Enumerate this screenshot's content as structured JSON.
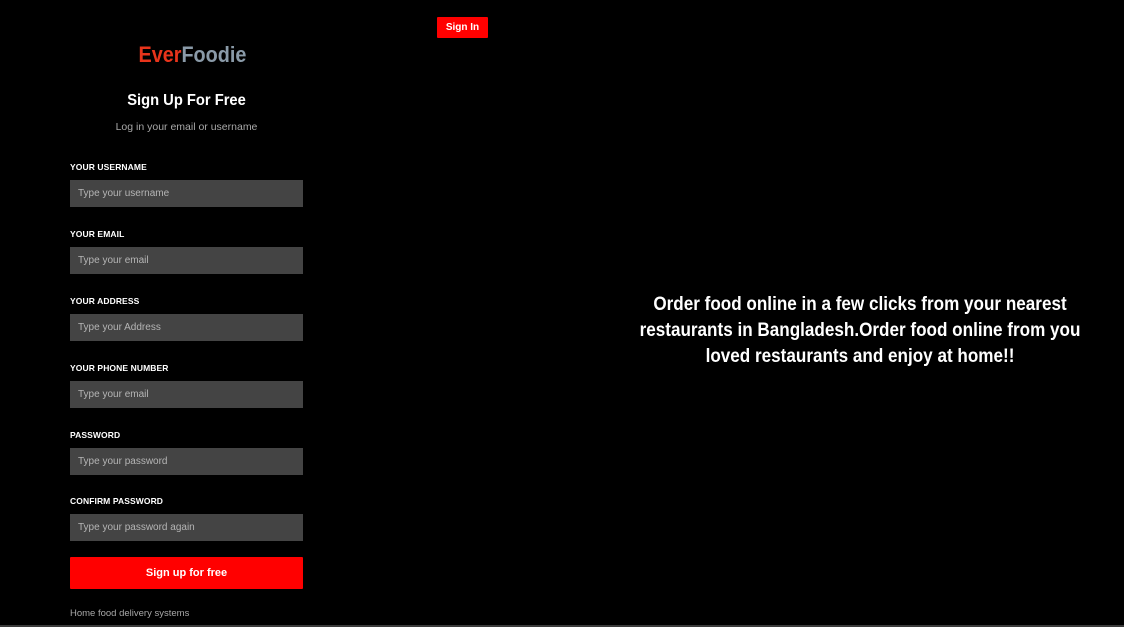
{
  "header": {
    "signin_label": "Sign In"
  },
  "brand": {
    "part1": "Ever",
    "part2": "Foodie",
    "colors": {
      "part1": "#e8341b",
      "part2": "#8a9aa8"
    }
  },
  "form": {
    "title": "Sign Up For Free",
    "subtitle": "Log in your email or username",
    "fields": [
      {
        "label": "YOUR USERNAME",
        "placeholder": "Type your username",
        "value": ""
      },
      {
        "label": "YOUR EMAIL",
        "placeholder": "Type your email",
        "value": ""
      },
      {
        "label": "YOUR ADDRESS",
        "placeholder": "Type your Address",
        "value": ""
      },
      {
        "label": "YOUR PHONE NUMBER",
        "placeholder": "Type your email",
        "value": ""
      },
      {
        "label": "PASSWORD",
        "placeholder": "Type your password",
        "value": ""
      },
      {
        "label": "CONFIRM PASSWORD",
        "placeholder": "Type your password again",
        "value": ""
      }
    ],
    "submit_label": "Sign up for free",
    "footer_note": "Home food delivery systems"
  },
  "hero": {
    "text": "Order food online in a few clicks from your nearest restaurants in Bangladesh.Order food online from you loved restaurants and enjoy at home!!"
  },
  "theme": {
    "background": "#000000",
    "accent": "#ff0000",
    "input_bg": "#444444"
  }
}
